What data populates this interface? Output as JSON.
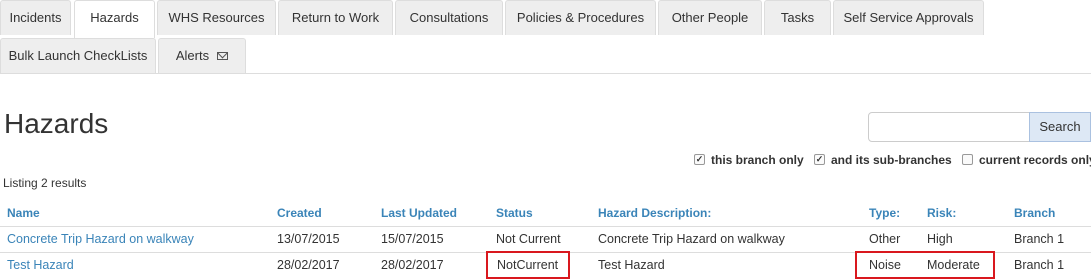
{
  "tabs": {
    "row1": [
      "Incidents",
      "Hazards",
      "WHS Resources",
      "Return to Work",
      "Consultations",
      "Policies & Procedures",
      "Other People",
      "Tasks",
      "Self Service Approvals"
    ],
    "row2": [
      "Bulk Launch CheckLists",
      "Alerts"
    ],
    "active": "Hazards"
  },
  "page": {
    "title": "Hazards",
    "listing": "Listing 2 results"
  },
  "search": {
    "button": "Search",
    "placeholder": ""
  },
  "filters": {
    "this_branch": {
      "label": "this branch only",
      "checked": true
    },
    "sub_branches": {
      "label": "and its sub-branches",
      "checked": true
    },
    "current": {
      "label": "current records only",
      "checked": false
    }
  },
  "table": {
    "headers": [
      "Name",
      "Created",
      "Last Updated",
      "Status",
      "Hazard Description:",
      "Type:",
      "Risk:",
      "Branch"
    ],
    "rows": [
      [
        "Concrete Trip Hazard on walkway",
        "13/07/2015",
        "15/07/2015",
        "Not Current",
        "Concrete Trip Hazard on walkway",
        "Other",
        "High",
        "Branch 1"
      ],
      [
        "Test Hazard",
        "28/02/2017",
        "28/02/2017",
        "NotCurrent",
        "Test Hazard",
        "Noise",
        "Moderate",
        "Branch 1"
      ]
    ]
  },
  "colors": {
    "link": "#3a84b8",
    "highlight": "#d9181e"
  }
}
